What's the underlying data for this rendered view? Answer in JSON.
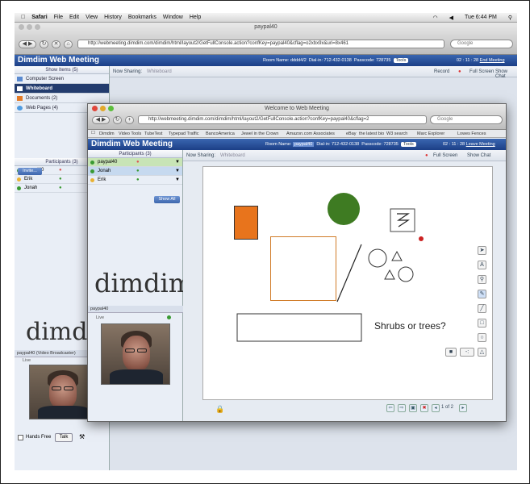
{
  "menubar": {
    "app": "Safari",
    "items": [
      "File",
      "Edit",
      "View",
      "History",
      "Bookmarks",
      "Window",
      "Help"
    ],
    "clock": "Tue 6:44 PM"
  },
  "bg_window": {
    "title": "paypal40",
    "url": "http://webmeeting.dimdim.com/dimdim/html/layout2/GetFullConsole.action?confKey=paypal40&cflag=o2xbx9x&uri=8x461",
    "search_placeholder": "Google",
    "brand": "Dimdim Web Meeting",
    "room_label": "Room Name:",
    "room_value": "dddd4/2",
    "dialin": "Dial-in: 712-432-0138",
    "passcode": "Passcode: 728735",
    "tools": "Tools",
    "timer": "02 : 11 : 28",
    "end_meeting": "End Meeting",
    "show_items_header": "Show Items (5)",
    "nav_items": [
      "Computer Screen",
      "Whiteboard",
      "Documents (2)",
      "Web Pages (4)"
    ],
    "now_sharing": "Now Sharing:",
    "now_sharing_value": "Whiteboard",
    "record": "Record",
    "full_screen": "Full Screen",
    "show_chat": "Show Chat",
    "participants_header": "Participants (3)",
    "participants": [
      "paypal40",
      "Erik",
      "Jonah"
    ],
    "invite": "Invite...",
    "logo": "dimdim",
    "video_header": "paypal40 (Video Broadcaster)",
    "video_live": "Live",
    "hands_free": "Hands Free",
    "talk": "Talk"
  },
  "fg_window": {
    "title": "Welcome to Web Meeting",
    "url": "http://webmeeting.dimdim.com/dimdim/html/layout2/GetFullConsole.action?confKey=paypal40&cflag=2",
    "search_placeholder": "Google",
    "bookmarks": [
      "Dimdim",
      "Video Tools",
      "TubeTest",
      "Typepad Traffic",
      "BancoAmerica",
      "Jewel in the Crown",
      "Amazon.com Associates",
      "eBay",
      "the latest bio",
      "W3 search",
      "Marc Explorer",
      "Lowes Fences"
    ],
    "brand": "Dimdim Web Meeting",
    "room_label": "Room Name:",
    "room_value": "paypal40",
    "dialin": "Dial-in: 712-432-0138",
    "passcode": "Passcode: 728735",
    "tools": "Tools",
    "timer": "02 : 11 : 28",
    "leave_meeting": "Leave Meeting",
    "participants_header": "Participants (3)",
    "participants": [
      "paypal40",
      "Jonah",
      "Erik"
    ],
    "show_all": "Show All",
    "logo": "dimdim",
    "video_header": "paypal40",
    "video_live": "Live",
    "now_sharing": "Now Sharing:",
    "now_sharing_value": "Whiteboard",
    "full_screen": "Full Screen",
    "show_chat": "Show Chat",
    "whiteboard_text": "Shrubs or trees?",
    "page_indicator": "1 of 2"
  },
  "colors": {
    "dimdim_blue": "#2a529b",
    "orange": "#e8741c",
    "green": "#3e7b22",
    "red": "#cc2222"
  }
}
